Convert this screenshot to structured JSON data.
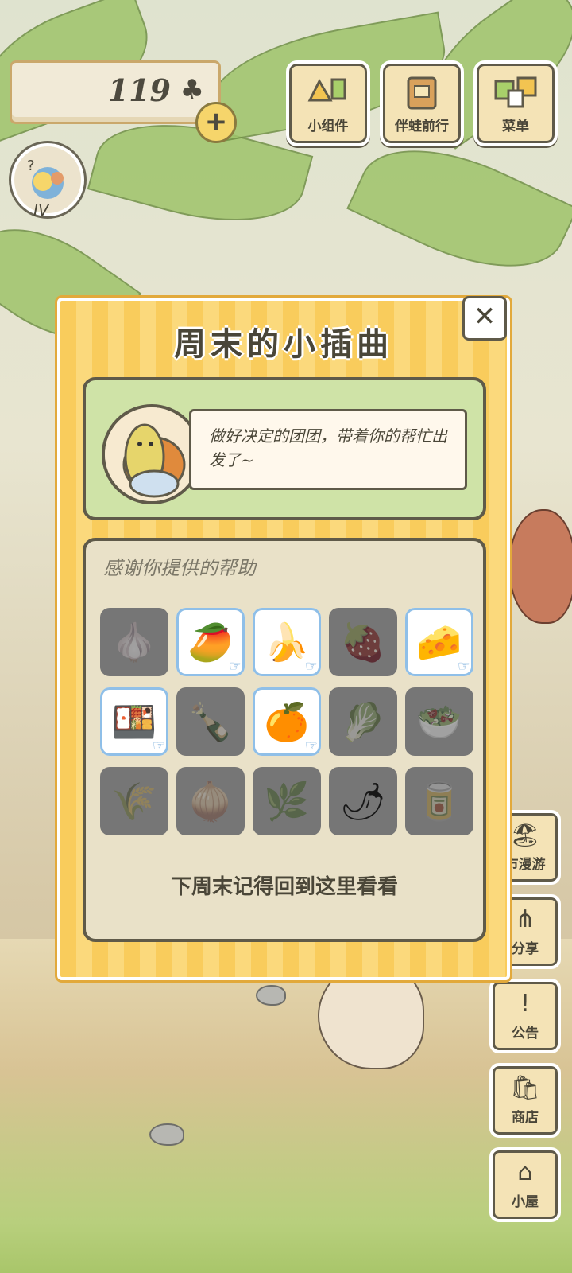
{
  "hud": {
    "clover_count": "119",
    "clover_symbol": "♣",
    "add_symbol": "+",
    "avatar_label": "IV"
  },
  "top_buttons": [
    {
      "label": "小组件",
      "icon": "widget-icon"
    },
    {
      "label": "伴蛙前行",
      "icon": "travel-book-icon"
    },
    {
      "label": "菜单",
      "icon": "menu-cards-icon"
    }
  ],
  "side_buttons": [
    {
      "label": "市漫游",
      "icon": "city-tour-icon"
    },
    {
      "label": "分享",
      "icon": "share-icon"
    },
    {
      "label": "公告",
      "icon": "announcement-icon"
    },
    {
      "label": "商店",
      "icon": "shop-icon"
    },
    {
      "label": "小屋",
      "icon": "house-icon"
    }
  ],
  "modal": {
    "title": "周末的小插曲",
    "close_symbol": "✕",
    "message": "做好决定的团团，带着你的帮忙出发了~",
    "items_title": "感谢你提供的帮助",
    "footer_note": "下周末记得回到这里看看",
    "items": [
      {
        "icon": "garlic-icon",
        "glyph": "🧄",
        "selected": false
      },
      {
        "icon": "mango-icon",
        "glyph": "🥭",
        "selected": true
      },
      {
        "icon": "banana-icon",
        "glyph": "🍌",
        "selected": true
      },
      {
        "icon": "strawberry-icon",
        "glyph": "🍓",
        "selected": false
      },
      {
        "icon": "cheese-icon",
        "glyph": "🧀",
        "selected": true
      },
      {
        "icon": "bento-box-icon",
        "glyph": "🍱",
        "selected": true
      },
      {
        "icon": "bottle-icon",
        "glyph": "🍾",
        "selected": false
      },
      {
        "icon": "orange-icon",
        "glyph": "🍊",
        "selected": true
      },
      {
        "icon": "cabbage-icon",
        "glyph": "🥬",
        "selected": false
      },
      {
        "icon": "salad-plate-icon",
        "glyph": "🥗",
        "selected": false
      },
      {
        "icon": "grain-sack-icon",
        "glyph": "🌾",
        "selected": false
      },
      {
        "icon": "onion-icon",
        "glyph": "🧅",
        "selected": false
      },
      {
        "icon": "scallion-icon",
        "glyph": "🌿",
        "selected": false
      },
      {
        "icon": "chili-pepper-icon",
        "glyph": "🌶",
        "selected": false
      },
      {
        "icon": "canned-food-icon",
        "glyph": "🥫",
        "selected": false
      }
    ]
  },
  "colors": {
    "modal_stripe_a": "#f9cc5c",
    "modal_stripe_b": "#fbd97c",
    "panel_green": "#cfe3a7",
    "selected_outline": "#8fbfe8",
    "text_dark": "#4a4638"
  }
}
